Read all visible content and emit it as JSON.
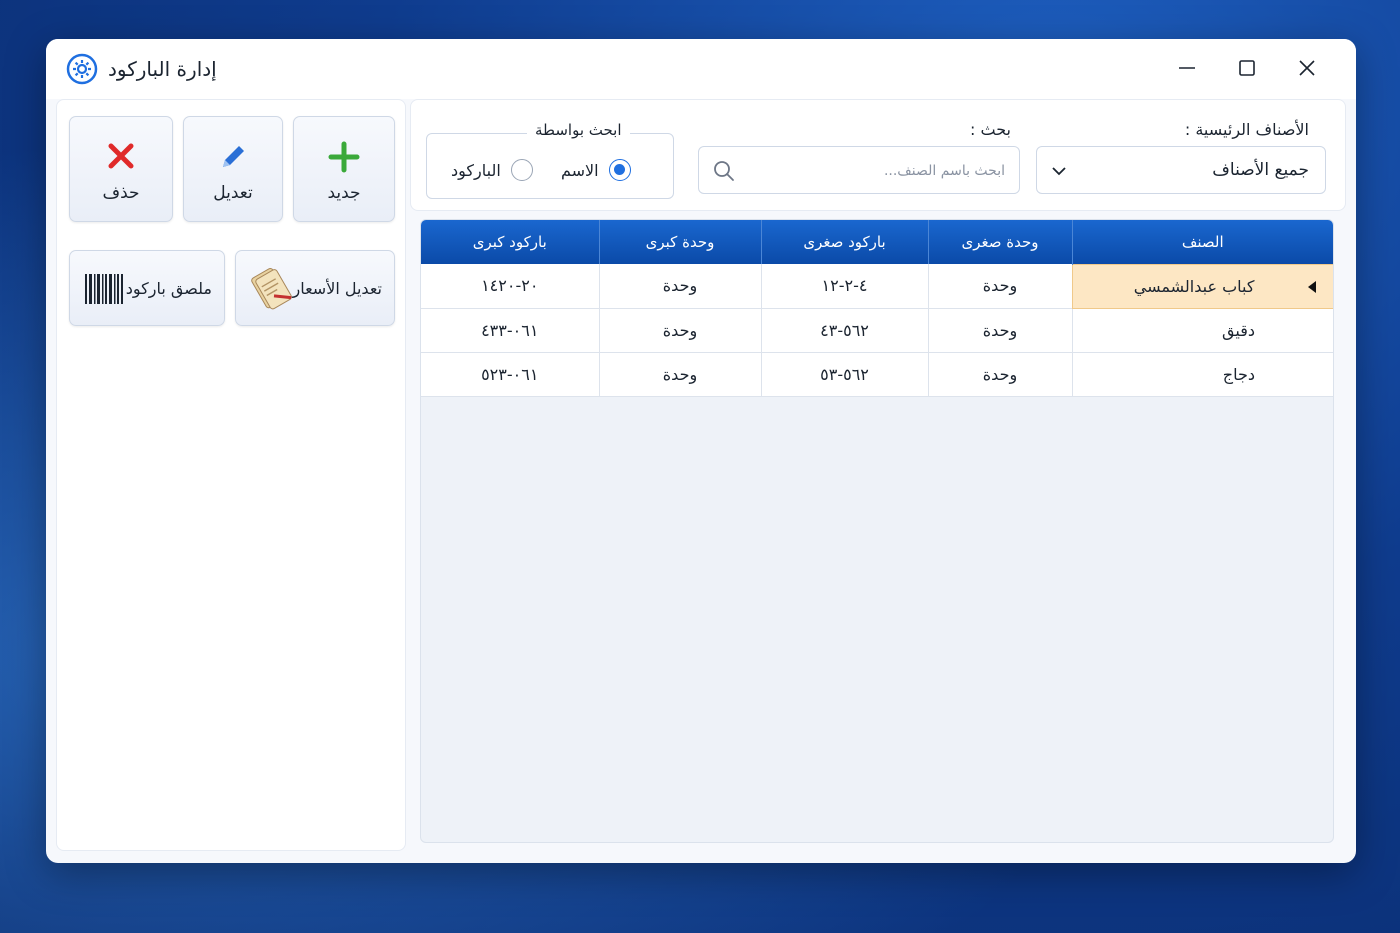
{
  "window": {
    "title": "إدارة الباركود",
    "app_icon": "gear-icon",
    "controls": [
      "minimize-icon",
      "maximize-icon",
      "close-icon"
    ]
  },
  "toolbar": {
    "new_label": "جديد",
    "edit_label": "تعديل",
    "delete_label": "حذف",
    "edit_prices_label": "تعديل الأسعار",
    "barcode_label_label": "ملصق باركود",
    "colors": {
      "new": "#3aa93a",
      "edit": "#2a6fd6",
      "delete": "#e02a2a"
    }
  },
  "filters": {
    "main_categories_label": "الأصناف الرئيسية :",
    "main_categories_value": "جميع الأصناف",
    "search_label": "بحث :",
    "search_placeholder": "ابحث باسم الصنف...",
    "search_by_title": "ابحث بواسطة",
    "search_by_options": [
      {
        "label": "الاسم",
        "selected": true
      },
      {
        "label": "الباركود",
        "selected": false
      }
    ]
  },
  "table": {
    "columns": [
      "الصنف",
      "وحدة صغرى",
      "باركود صغرى",
      "وحدة كبرى",
      "باركود كبرى"
    ],
    "rows": [
      {
        "item": "كباب عبدالشمسي",
        "small_unit": "وحدة",
        "small_barcode": "٤-٢-١٢",
        "large_unit": "وحدة",
        "large_barcode": "٢٠-١٤٢٠",
        "selected": true
      },
      {
        "item": "دقيق",
        "small_unit": "وحدة",
        "small_barcode": "٥٦٢-٤٣",
        "large_unit": "وحدة",
        "large_barcode": "٠٦١-٤٣٣",
        "selected": false
      },
      {
        "item": "دجاج",
        "small_unit": "وحدة",
        "small_barcode": "٥٦٢-٥٣",
        "large_unit": "وحدة",
        "large_barcode": "٠٦١-٥٢٣",
        "selected": false
      }
    ],
    "header_color": "#0b4aa8",
    "selected_row_color": "#fde7c4"
  }
}
